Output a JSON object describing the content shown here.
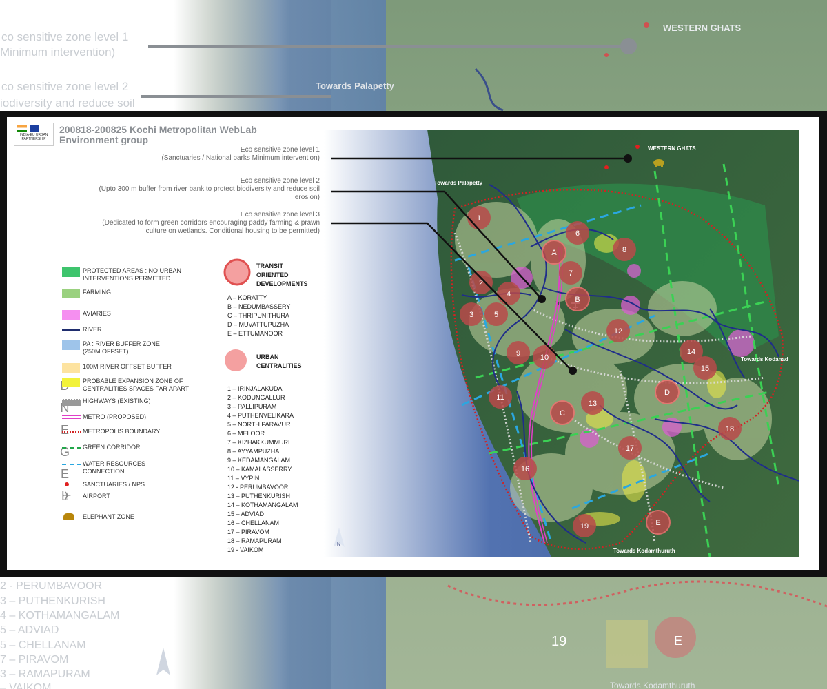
{
  "background": {
    "texts": [
      {
        "id": "bg-eco1",
        "text": "co sensitive zone level 1"
      },
      {
        "id": "bg-eco1b",
        "text": "Minimum intervention)"
      },
      {
        "id": "bg-eco2",
        "text": "co sensitive zone level 2"
      },
      {
        "id": "bg-eco2b",
        "text": "iodiversity and reduce soil"
      },
      {
        "id": "bg-wg",
        "text": "WESTERN GHATS"
      },
      {
        "id": "bg-pal",
        "text": "Towards Palapetty"
      },
      {
        "id": "bg-19",
        "text": "19"
      },
      {
        "id": "bg-e",
        "text": "E"
      },
      {
        "id": "bg-kodam",
        "text": "Towards Kodamthuruth"
      }
    ],
    "legend_items": [
      "2 - PERUMBAVOOR",
      "3 – PUTHENKURISH",
      "4 – KOTHAMANGALAM",
      "5 – ADVIAD",
      "5 – CHELLANAM",
      "7 – PIRAVOM",
      "3 – RAMAPURAM",
      "– VAIKOM"
    ]
  },
  "header": {
    "logo_text": "INDIA-EU URBAN PARTNERSHIP",
    "title_line1": "200818-200825 Kochi Metropolitan WebLab",
    "title_line2": "Environment group"
  },
  "zones": [
    {
      "title": "Eco sensitive zone level 1",
      "desc": "(Sanctuaries / National parks Minimum intervention)"
    },
    {
      "title": "Eco sensitive zone level 2",
      "desc": "(Upto 300 m buffer from river bank to protect biodiversity and reduce soil",
      "desc2": "erosion)"
    },
    {
      "title": "Eco sensitive zone level 3",
      "desc": "(Dedicated to form green corridors encouraging paddy farming & prawn",
      "desc2": "culture on wetlands. Conditional housing to be permitted)"
    }
  ],
  "legend": {
    "vertical_title": [
      "D",
      "N",
      "E",
      "G",
      "E",
      "L"
    ],
    "items": [
      {
        "label": "PROTECTED AREAS : NO URBAN",
        "label2": "INTERVENTIONS PERMITTED",
        "color": "#3ec46d",
        "icon": "rect-icon"
      },
      {
        "label": "FARMING",
        "color": "#9ad17f",
        "icon": "rect-icon"
      },
      {
        "label": "AVIARIES",
        "color": "#f58ff0",
        "icon": "rect-icon"
      },
      {
        "label": "RIVER",
        "color": "#1f2d6e",
        "icon": "line-icon"
      },
      {
        "label": "PA : RIVER BUFFER ZONE",
        "label2": "(250M OFFSET)",
        "color": "#9ec4ea",
        "icon": "rect-icon"
      },
      {
        "label": "100M RIVER OFFSET BUFFER",
        "color": "#fde3a0",
        "icon": "rect-icon"
      },
      {
        "label": "PROBABLE EXPANSION ZONE OF",
        "label2": "CENTRALITIES SPACES FAR APART",
        "color": "#f2f23a",
        "icon": "rect-icon"
      },
      {
        "label": "HIGHWAYS (EXISTING)",
        "color": "#999999",
        "icon": "dotted-band-icon"
      },
      {
        "label": "METRO (PROPOSED)",
        "color": "#e040c8",
        "icon": "double-line-icon"
      },
      {
        "label": "METROPOLIS BOUNDARY",
        "color": "#d22222",
        "icon": "dotted-line-icon"
      },
      {
        "label": "GREEN CORRIDOR",
        "color": "#22a64a",
        "icon": "dashed-line-icon"
      },
      {
        "label": "WATER RESOURCES",
        "label2": "CONNECTION",
        "color": "#2aa7e0",
        "icon": "dashed-line-icon"
      },
      {
        "label": "SANCTUARIES / NPS",
        "color": "#e02020",
        "icon": "dot-icon"
      },
      {
        "label": "AIRPORT",
        "color": "#888888",
        "icon": "airplane-icon"
      },
      {
        "label": "ELEPHANT ZONE",
        "color": "#b8860b",
        "icon": "elephant-icon"
      }
    ]
  },
  "tod": {
    "heading": [
      "TRANSIT",
      "ORIENTED",
      "DEVELOPMENTS"
    ],
    "items": [
      "A – KORATTY",
      "B – NEDUMBASSERY",
      "C – THRIPUNITHURA",
      "D – MUVATTUPUZHA",
      "E – ETTUMANOOR"
    ]
  },
  "centralities": {
    "heading": [
      "URBAN",
      "CENTRALITIES"
    ],
    "items": [
      "1 – IRINJALAKUDA",
      "2 – KODUNGALLUR",
      "3 – PALLIPURAM",
      "4 – PUTHENVELIKARA",
      "5 – NORTH PARAVUR",
      "6 – MELOOR",
      "7 – KIZHAKKUMMURI",
      "8 – AYYAMPUZHA",
      "9 – KEDAMANGALAM",
      "10 – KAMALASSERRY",
      "11 – VYPIN",
      "12 - PERUMBAVOOR",
      "13 – PUTHENKURISH",
      "14 – KOTHAMANGALAM",
      "15 – ADVIAD",
      "16 – CHELLANAM",
      "17 – PIRAVOM",
      "18 – RAMAPURAM",
      "19 - VAIKOM"
    ]
  },
  "map": {
    "places": {
      "western_ghats": "WESTERN GHATS",
      "palapetty": "Towards Palapetty",
      "kodanad": "Towards Kodanad",
      "kodamthuruth": "Towards Kodamthuruth",
      "north": "N"
    },
    "centrality_markers": [
      {
        "label": "1"
      },
      {
        "label": "2"
      },
      {
        "label": "3"
      },
      {
        "label": "4"
      },
      {
        "label": "5"
      },
      {
        "label": "6"
      },
      {
        "label": "7"
      },
      {
        "label": "8"
      },
      {
        "label": "9"
      },
      {
        "label": "10"
      },
      {
        "label": "11"
      },
      {
        "label": "12"
      },
      {
        "label": "13"
      },
      {
        "label": "14"
      },
      {
        "label": "15"
      },
      {
        "label": "16"
      },
      {
        "label": "17"
      },
      {
        "label": "18"
      },
      {
        "label": "19"
      }
    ],
    "tod_markers": [
      {
        "label": "A"
      },
      {
        "label": "B"
      },
      {
        "label": "C"
      },
      {
        "label": "D"
      },
      {
        "label": "E"
      }
    ]
  }
}
